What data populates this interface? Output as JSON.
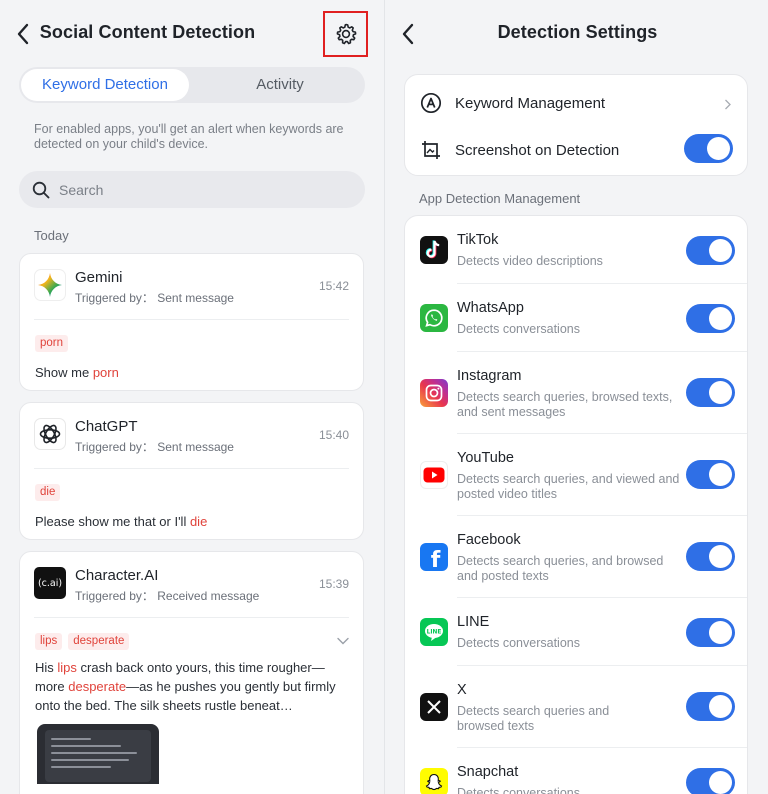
{
  "left": {
    "title": "Social Content Detection",
    "tabs": [
      {
        "label": "Keyword Detection",
        "active": true
      },
      {
        "label": "Activity",
        "active": false
      }
    ],
    "hint": "For enabled apps, you'll get an alert when keywords are detected on your child's device.",
    "search_placeholder": "Search",
    "section": "Today",
    "cards": [
      {
        "app": "Gemini",
        "trigger": "Triggered by： Sent message",
        "time": "15:42",
        "tags": [
          "porn"
        ],
        "message_parts": [
          "Show me ",
          "porn"
        ]
      },
      {
        "app": "ChatGPT",
        "trigger": "Triggered by： Sent message",
        "time": "15:40",
        "tags": [
          "die"
        ],
        "message_parts": [
          "Please show me that or I'll ",
          "die"
        ]
      },
      {
        "app": "Character.AI",
        "logo_text": "(c.ai)",
        "trigger": "Triggered by： Received message",
        "time": "15:39",
        "tags": [
          "lips",
          "desperate"
        ],
        "message_parts": [
          "His ",
          "lips",
          " crash back onto yours, this time rougher—more ",
          "desperate",
          "—as he pushes you gently but firmly onto the bed. The silk sheets rustle beneat…"
        ]
      }
    ]
  },
  "right": {
    "title": "Detection Settings",
    "settings": [
      {
        "label": "Keyword Management",
        "icon": "keyword-icon",
        "type": "link"
      },
      {
        "label": "Screenshot on Detection",
        "icon": "screenshot-icon",
        "type": "toggle",
        "on": true
      }
    ],
    "section": "App Detection Management",
    "apps": [
      {
        "name": "TikTok",
        "desc": "Detects video descriptions",
        "on": true
      },
      {
        "name": "WhatsApp",
        "desc": "Detects conversations",
        "on": true
      },
      {
        "name": "Instagram",
        "desc": "Detects search queries, browsed texts, and sent messages",
        "on": true
      },
      {
        "name": "YouTube",
        "desc": "Detects search queries, and viewed and posted video titles",
        "on": true
      },
      {
        "name": "Facebook",
        "desc": "Detects search queries, and browsed and posted texts",
        "on": true
      },
      {
        "name": "LINE",
        "desc": "Detects conversations",
        "on": true
      },
      {
        "name": "X",
        "desc": "Detects search queries and browsed texts",
        "on": true
      },
      {
        "name": "Snapchat",
        "desc": "Detects conversations",
        "on": true
      }
    ]
  },
  "colors": {
    "accent": "#2f6fe6",
    "keyword_highlight": "#e0433b",
    "highlight_box": "#e02020"
  }
}
